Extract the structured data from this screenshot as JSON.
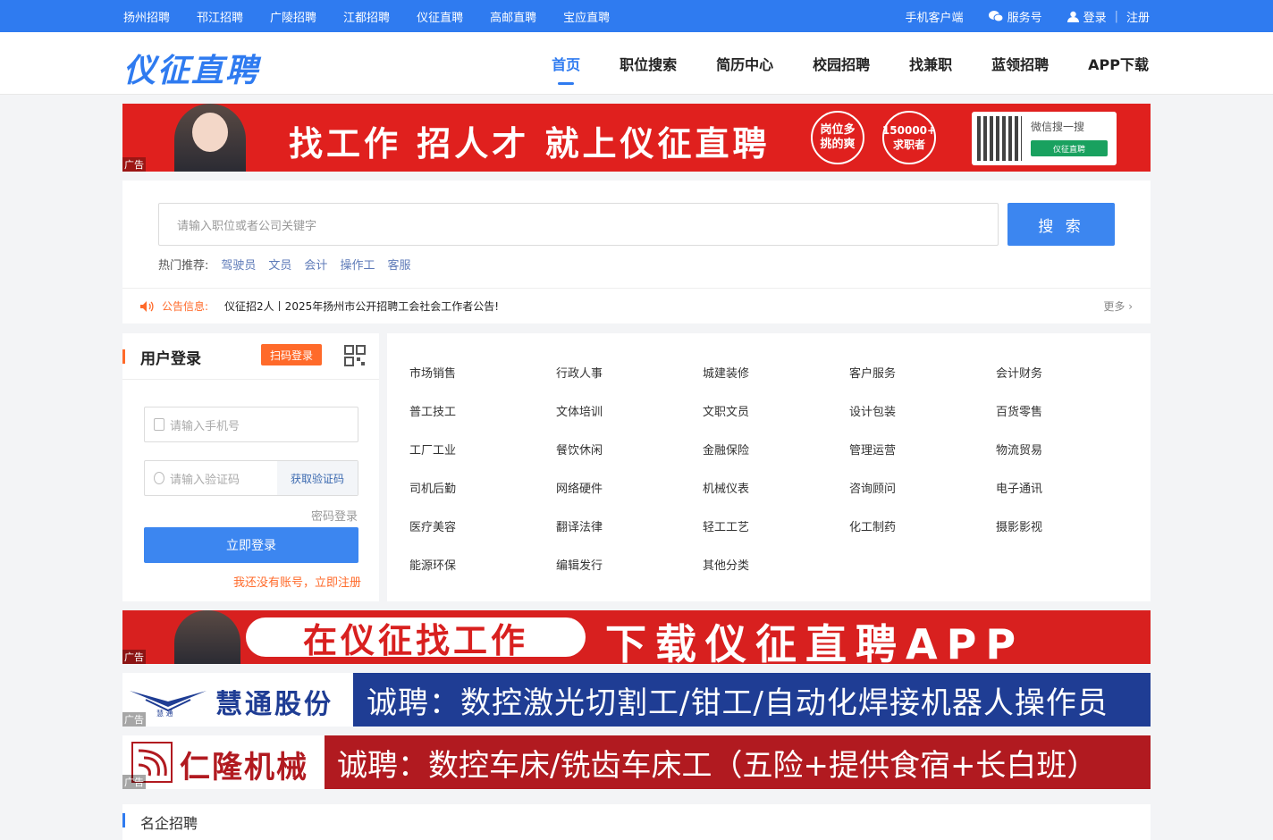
{
  "topbar": {
    "links": [
      "扬州招聘",
      "邗江招聘",
      "广陵招聘",
      "江都招聘",
      "仪征直聘",
      "高邮直聘",
      "宝应直聘"
    ],
    "mobile": "手机客户端",
    "service": "服务号",
    "login": "登录",
    "register": "注册"
  },
  "header": {
    "logo": "仪征直聘",
    "nav": [
      "首页",
      "职位搜索",
      "简历中心",
      "校园招聘",
      "找兼职",
      "蓝领招聘",
      "APP下载"
    ]
  },
  "banner1": {
    "adtag": "广告",
    "slogan": "找工作 招人才 就上仪征直聘",
    "circle1": "岗位多\n挑的爽",
    "circle2": "150000+\n求职者",
    "wechat_text": "微信搜一搜",
    "wechat_btn": "仪征直聘"
  },
  "search": {
    "placeholder": "请输入职位或者公司关键字",
    "button": "搜 索",
    "hot_label": "热门推荐:",
    "hot": [
      "驾驶员",
      "文员",
      "会计",
      "操作工",
      "客服"
    ]
  },
  "notice": {
    "label": "公告信息:",
    "text": "仪征招2人丨2025年扬州市公开招聘工会社会工作者公告!",
    "more": "更多 ›"
  },
  "login": {
    "title": "用户登录",
    "scan": "扫码登录",
    "phone_placeholder": "请输入手机号",
    "code_placeholder": "请输入验证码",
    "get_code": "获取验证码",
    "pwd_login": "密码登录",
    "submit": "立即登录",
    "register": "我还没有账号，立即注册"
  },
  "categories": [
    [
      "市场销售",
      "行政人事",
      "城建装修",
      "客户服务",
      "会计财务"
    ],
    [
      "普工技工",
      "文体培训",
      "文职文员",
      "设计包装",
      "百货零售"
    ],
    [
      "工厂工业",
      "餐饮休闲",
      "金融保险",
      "管理运营",
      "物流贸易"
    ],
    [
      "司机后勤",
      "网络硬件",
      "机械仪表",
      "咨询顾问",
      "电子通讯"
    ],
    [
      "医疗美容",
      "翻译法律",
      "轻工工艺",
      "化工制药",
      "摄影影视"
    ],
    [
      "能源环保",
      "编辑发行",
      "其他分类"
    ]
  ],
  "ad2": {
    "adtag": "广告",
    "pill": "在仪征找工作",
    "big": "下载仪征直聘APP"
  },
  "ad3": {
    "adtag": "广告",
    "brand": "慧通股份",
    "brand_sub": "慧 通",
    "text": "诚聘：数控激光切割工/钳工/自动化焊接机器人操作员"
  },
  "ad4": {
    "adtag": "广告",
    "brand": "仁隆机械",
    "text": "诚聘：数控车床/铣齿车床工（五险+提供食宿+长白班）"
  },
  "section": {
    "title": "名企招聘"
  },
  "colors": {
    "primary": "#2f7bf0",
    "accent": "#ff6a2a",
    "banner_red": "#e0201e"
  }
}
